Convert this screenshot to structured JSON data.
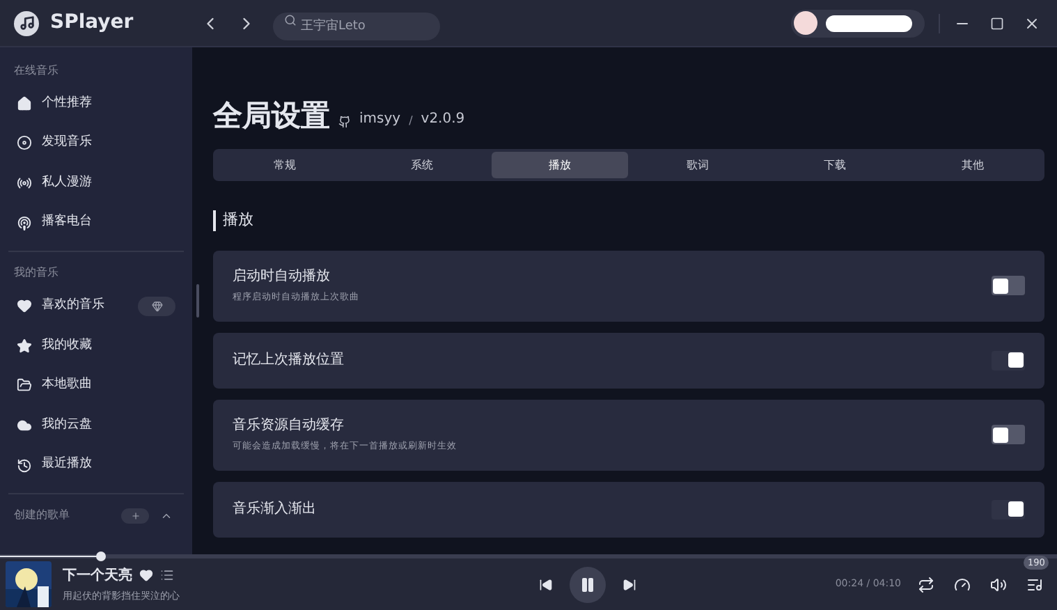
{
  "app": {
    "name": "SPlayer"
  },
  "search": {
    "placeholder": "王宇宙Leto"
  },
  "sidebar": {
    "sections": [
      {
        "title": "在线音乐",
        "items": [
          {
            "label": "个性推荐"
          },
          {
            "label": "发现音乐"
          },
          {
            "label": "私人漫游"
          },
          {
            "label": "播客电台"
          }
        ]
      },
      {
        "title": "我的音乐",
        "items": [
          {
            "label": "喜欢的音乐"
          },
          {
            "label": "我的收藏"
          },
          {
            "label": "本地歌曲"
          },
          {
            "label": "我的云盘"
          },
          {
            "label": "最近播放"
          }
        ]
      },
      {
        "title": "创建的歌单"
      }
    ]
  },
  "page": {
    "title": "全局设置",
    "author": "imsyy",
    "separator": "/",
    "version": "v2.0.9"
  },
  "tabs": [
    {
      "label": "常规",
      "selected": false
    },
    {
      "label": "系统",
      "selected": false
    },
    {
      "label": "播放",
      "selected": true
    },
    {
      "label": "歌词",
      "selected": false
    },
    {
      "label": "下载",
      "selected": false
    },
    {
      "label": "其他",
      "selected": false
    }
  ],
  "section": {
    "title": "播放"
  },
  "settings": [
    {
      "label": "启动时自动播放",
      "description": "程序启动时自动播放上次歌曲",
      "on": false
    },
    {
      "label": "记忆上次播放位置",
      "on": true
    },
    {
      "label": "音乐资源自动缓存",
      "description": "可能会造成加载缓慢，将在下一首播放或刷新时生效",
      "on": false
    },
    {
      "label": "音乐渐入渐出",
      "on": true
    }
  ],
  "player": {
    "title": "下一个天亮",
    "lyric": "用起伏的背影挡住哭泣的心",
    "playing": true,
    "time": "00:24 / 04:10",
    "progress": {
      "level": 0.095
    },
    "queue_count": "190"
  }
}
